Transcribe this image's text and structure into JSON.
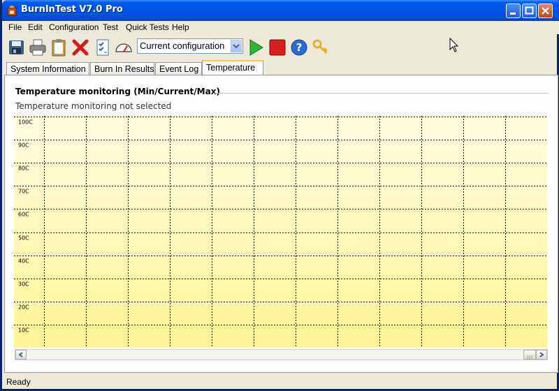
{
  "window": {
    "title": "BurnInTest V7.0 Pro"
  },
  "menu": [
    "File",
    "Edit",
    "Configuration",
    "Test",
    "Quick Tests",
    "Help"
  ],
  "toolbar": {
    "icons": [
      "save-icon",
      "print-icon",
      "clipboard-icon",
      "stop-delete-icon",
      "checklist-icon",
      "gauge-icon"
    ],
    "config_select": "Current configuration",
    "run_icons": [
      "play-icon",
      "stop-icon",
      "help-icon",
      "key-icon"
    ]
  },
  "tabs": [
    {
      "label": "System Information"
    },
    {
      "label": "Burn In Results"
    },
    {
      "label": "Event Log"
    },
    {
      "label": "Temperature",
      "active": true
    }
  ],
  "temperature": {
    "heading": "Temperature monitoring  (Min/Current/Max)",
    "status": "Temperature monitoring not selected"
  },
  "chart_data": {
    "type": "line",
    "y_tick_labels": [
      "100C",
      "90C",
      "80C",
      "70C",
      "60C",
      "50C",
      "40C",
      "30C",
      "20C",
      "10C"
    ],
    "ylim": [
      0,
      100
    ],
    "series": [],
    "grid": true,
    "background_gradient": [
      "#fffde0",
      "#fff596"
    ]
  },
  "statusbar": {
    "text": "Ready"
  }
}
